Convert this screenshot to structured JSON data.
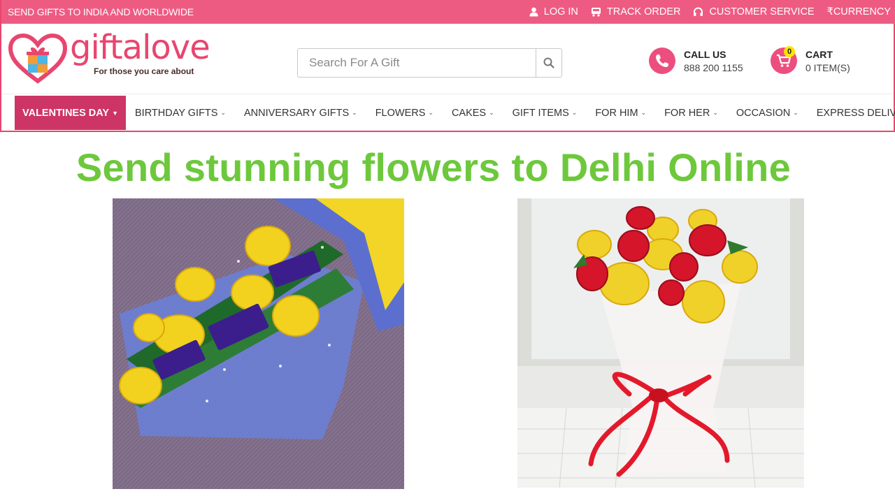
{
  "topbar": {
    "promo": "SEND GIFTS TO INDIA AND WORLDWIDE",
    "login": "LOG IN",
    "track_order": "TRACK ORDER",
    "customer_service": "CUSTOMER SERVICE",
    "currency": "₹CURRENCY"
  },
  "logo": {
    "brand": "giftalove",
    "tagline": "For those you care about"
  },
  "search": {
    "placeholder": "Search For A Gift"
  },
  "call": {
    "label": "CALL US",
    "number": "888 200 1155"
  },
  "cart": {
    "label": "CART",
    "count": "0",
    "items": "0 ITEM(S)"
  },
  "nav": {
    "items": [
      "VALENTINES DAY",
      "BIRTHDAY GIFTS",
      "ANNIVERSARY GIFTS",
      "FLOWERS",
      "CAKES",
      "GIFT ITEMS",
      "FOR HIM",
      "FOR HER",
      "OCCASION",
      "EXPRESS DELIVERY"
    ]
  },
  "banner": {
    "headline": "Send stunning flowers to Delhi Online"
  },
  "colors": {
    "topbar": "#ee5b82",
    "brand_pink": "#e8466f",
    "active_nav": "#cd3566",
    "headline_green": "#6dc83c",
    "badge_yellow": "#ffe400"
  },
  "icons": [
    "user-icon",
    "truck-icon",
    "headset-icon",
    "search-icon",
    "phone-icon",
    "cart-icon",
    "chevron-down-icon"
  ]
}
